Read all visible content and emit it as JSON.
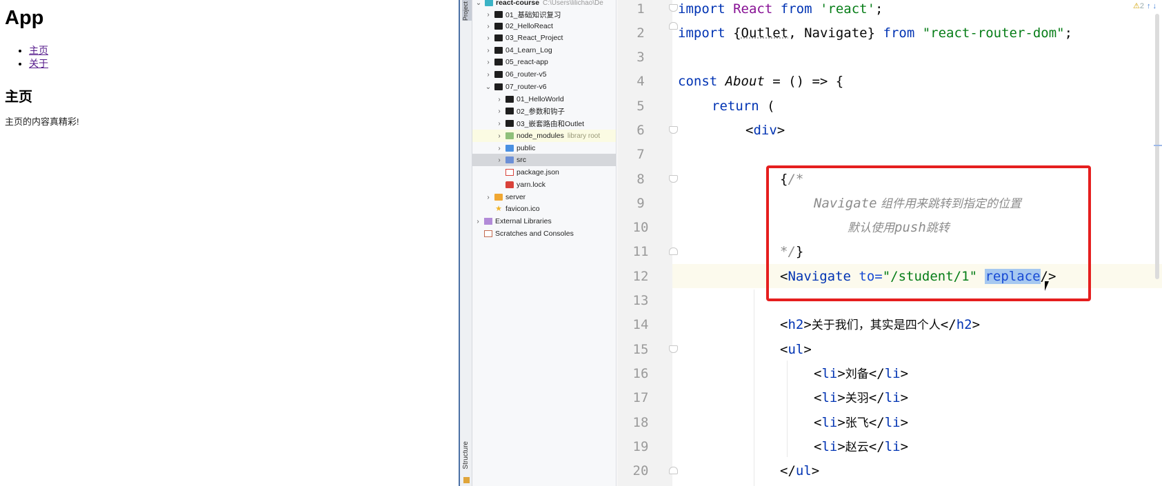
{
  "browser": {
    "app_title": "App",
    "nav_links": [
      "主页",
      "关于"
    ],
    "page_heading": "主页",
    "page_text": "主页的内容真精彩!"
  },
  "ide": {
    "tool_tabs": {
      "project": "Project",
      "structure": "Structure"
    },
    "project_tree": {
      "root_name": "react-course",
      "root_path": "C:\\Users\\lilichao\\De",
      "items": [
        {
          "label": "01_基础知识复习",
          "kind": "folder"
        },
        {
          "label": "02_HelloReact",
          "kind": "folder"
        },
        {
          "label": "03_React_Project",
          "kind": "folder"
        },
        {
          "label": "04_Learn_Log",
          "kind": "folder"
        },
        {
          "label": "05_react-app",
          "kind": "folder"
        },
        {
          "label": "06_router-v5",
          "kind": "folder"
        },
        {
          "label": "07_router-v6",
          "kind": "folder-open"
        },
        {
          "label": "01_HelloWorld",
          "kind": "folder"
        },
        {
          "label": "02_参数和钩子",
          "kind": "folder"
        },
        {
          "label": "03_嵌套路由和Outlet",
          "kind": "folder"
        },
        {
          "label": "node_modules",
          "kind": "folder-green",
          "note": "library root"
        },
        {
          "label": "public",
          "kind": "folder-blue"
        },
        {
          "label": "src",
          "kind": "folder-src"
        },
        {
          "label": "package.json",
          "kind": "json"
        },
        {
          "label": "yarn.lock",
          "kind": "lock"
        },
        {
          "label": "server",
          "kind": "folder-orange"
        },
        {
          "label": "favicon.ico",
          "kind": "star"
        },
        {
          "label": "External Libraries",
          "kind": "lib"
        },
        {
          "label": "Scratches and Consoles",
          "kind": "scratch"
        }
      ]
    },
    "inspection": {
      "warning_count": "2"
    },
    "editor": {
      "line_numbers": [
        "1",
        "2",
        "3",
        "4",
        "5",
        "6",
        "7",
        "8",
        "9",
        "10",
        "11",
        "12",
        "13",
        "14",
        "15",
        "16",
        "17",
        "18",
        "19",
        "20"
      ],
      "lines": {
        "l1": {
          "import": "import",
          "react": "React",
          "from": "from",
          "module": "'react'",
          "semi": ";"
        },
        "l2": {
          "import": "import",
          "open": "{",
          "outlet": "Outlet",
          "comma": ", ",
          "navigate": "Navigate",
          "close": "}",
          "from": "from",
          "module": "\"react-router-dom\"",
          "semi": ";"
        },
        "l4": {
          "const": "const",
          "name": "About",
          "rest": " = () => {"
        },
        "l5": {
          "ret": "return",
          "paren": " ("
        },
        "l6": {
          "open": "<",
          "tag": "div",
          "close": ">"
        },
        "l8": {
          "brace": "{",
          "cmt": "/*"
        },
        "l9": {
          "nav": "Navigate",
          "cn": " 组件用来跳转到指定的位置"
        },
        "l10": {
          "cn1": "默认使用",
          "push": "push",
          "cn2": "跳转"
        },
        "l11": {
          "cmt": "*/",
          "brace": "}"
        },
        "l12": {
          "open": "<",
          "tag": "Navigate",
          "attr": " to=",
          "val": "\"/student/1\"",
          "sp": " ",
          "replace": "replace",
          "close": "/>"
        },
        "l14": {
          "o1": "<",
          "t1": "h2",
          "c1": ">",
          "text": "关于我们，其实是四个人",
          "o2": "</",
          "t2": "h2",
          "c2": ">"
        },
        "l15": {
          "open": "<",
          "tag": "ul",
          "close": ">"
        },
        "li_items": [
          "刘备",
          "关羽",
          "张飞",
          "赵云"
        ],
        "li_tag": "li",
        "l20": {
          "open": "</",
          "tag": "ul",
          "close": ">"
        }
      }
    }
  }
}
